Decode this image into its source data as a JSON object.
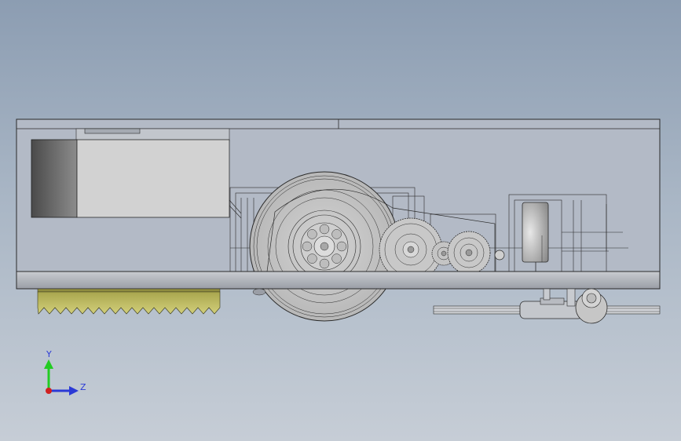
{
  "viewport": {
    "background_top": "#8c9db2",
    "background_bottom": "#c6cdd6"
  },
  "model": {
    "body_color": "#b3bac6",
    "base_color": "#b9bcc2",
    "brush_color": "#b8b55e",
    "stroke_color": "#2a2a2a"
  },
  "triad": {
    "y_label": "Y",
    "z_label": "Z",
    "y_color": "#22cc22",
    "z_color": "#2b3ad6",
    "origin_color": "#d02020"
  }
}
